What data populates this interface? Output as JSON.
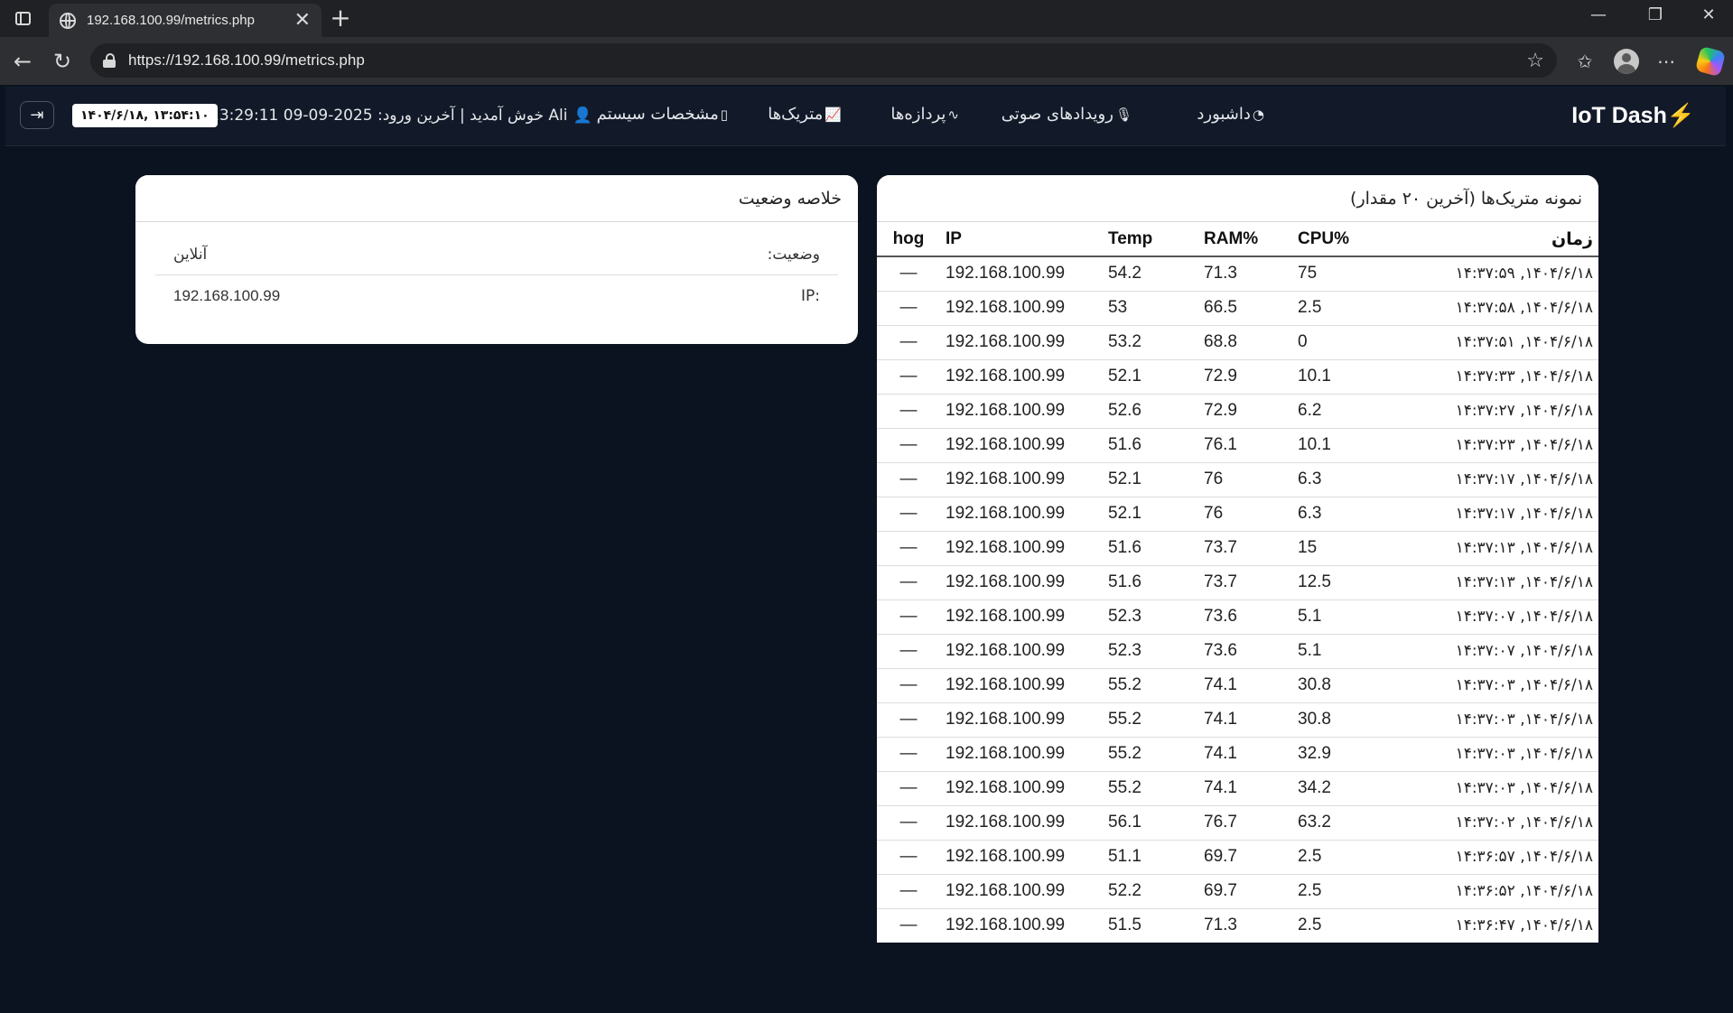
{
  "browser": {
    "tab_title": "192.168.100.99/metrics.php",
    "url": "https://192.168.100.99/metrics.php"
  },
  "nav": {
    "brand": "IoT Dash",
    "dashboard": "داشبورد",
    "audio_events": "رویدادهای صوتی",
    "processes": "پردازه‌ها",
    "metrics": "متریک‌ها",
    "system_specs": "مشخصات سیستم",
    "welcome": "Ali خوش آمدید | آخرین ورود: 2025-09-09 13:29:11",
    "clock": "۱۴۰۴/۶/۱۸, ۱۳:۵۴:۱۰"
  },
  "metrics_card": {
    "title": "نمونه متریک‌ها (آخرین ۲۰ مقدار)",
    "columns": {
      "time": "زمان",
      "cpu": "%CPU",
      "ram": "%RAM",
      "temp": "Temp",
      "ip": "IP",
      "hog": "hog"
    },
    "rows": [
      {
        "time": "۱۴۰۴/۶/۱۸, ۱۴:۳۷:۵۹",
        "cpu": "75",
        "ram": "71.3",
        "temp": "54.2",
        "ip": "192.168.100.99",
        "hog": "—"
      },
      {
        "time": "۱۴۰۴/۶/۱۸, ۱۴:۳۷:۵۸",
        "cpu": "2.5",
        "ram": "66.5",
        "temp": "53",
        "ip": "192.168.100.99",
        "hog": "—"
      },
      {
        "time": "۱۴۰۴/۶/۱۸, ۱۴:۳۷:۵۱",
        "cpu": "0",
        "ram": "68.8",
        "temp": "53.2",
        "ip": "192.168.100.99",
        "hog": "—"
      },
      {
        "time": "۱۴۰۴/۶/۱۸, ۱۴:۳۷:۳۳",
        "cpu": "10.1",
        "ram": "72.9",
        "temp": "52.1",
        "ip": "192.168.100.99",
        "hog": "—"
      },
      {
        "time": "۱۴۰۴/۶/۱۸, ۱۴:۳۷:۲۷",
        "cpu": "6.2",
        "ram": "72.9",
        "temp": "52.6",
        "ip": "192.168.100.99",
        "hog": "—"
      },
      {
        "time": "۱۴۰۴/۶/۱۸, ۱۴:۳۷:۲۳",
        "cpu": "10.1",
        "ram": "76.1",
        "temp": "51.6",
        "ip": "192.168.100.99",
        "hog": "—"
      },
      {
        "time": "۱۴۰۴/۶/۱۸, ۱۴:۳۷:۱۷",
        "cpu": "6.3",
        "ram": "76",
        "temp": "52.1",
        "ip": "192.168.100.99",
        "hog": "—"
      },
      {
        "time": "۱۴۰۴/۶/۱۸, ۱۴:۳۷:۱۷",
        "cpu": "6.3",
        "ram": "76",
        "temp": "52.1",
        "ip": "192.168.100.99",
        "hog": "—"
      },
      {
        "time": "۱۴۰۴/۶/۱۸, ۱۴:۳۷:۱۳",
        "cpu": "15",
        "ram": "73.7",
        "temp": "51.6",
        "ip": "192.168.100.99",
        "hog": "—"
      },
      {
        "time": "۱۴۰۴/۶/۱۸, ۱۴:۳۷:۱۳",
        "cpu": "12.5",
        "ram": "73.7",
        "temp": "51.6",
        "ip": "192.168.100.99",
        "hog": "—"
      },
      {
        "time": "۱۴۰۴/۶/۱۸, ۱۴:۳۷:۰۷",
        "cpu": "5.1",
        "ram": "73.6",
        "temp": "52.3",
        "ip": "192.168.100.99",
        "hog": "—"
      },
      {
        "time": "۱۴۰۴/۶/۱۸, ۱۴:۳۷:۰۷",
        "cpu": "5.1",
        "ram": "73.6",
        "temp": "52.3",
        "ip": "192.168.100.99",
        "hog": "—"
      },
      {
        "time": "۱۴۰۴/۶/۱۸, ۱۴:۳۷:۰۳",
        "cpu": "30.8",
        "ram": "74.1",
        "temp": "55.2",
        "ip": "192.168.100.99",
        "hog": "—"
      },
      {
        "time": "۱۴۰۴/۶/۱۸, ۱۴:۳۷:۰۳",
        "cpu": "30.8",
        "ram": "74.1",
        "temp": "55.2",
        "ip": "192.168.100.99",
        "hog": "—"
      },
      {
        "time": "۱۴۰۴/۶/۱۸, ۱۴:۳۷:۰۳",
        "cpu": "32.9",
        "ram": "74.1",
        "temp": "55.2",
        "ip": "192.168.100.99",
        "hog": "—"
      },
      {
        "time": "۱۴۰۴/۶/۱۸, ۱۴:۳۷:۰۳",
        "cpu": "34.2",
        "ram": "74.1",
        "temp": "55.2",
        "ip": "192.168.100.99",
        "hog": "—"
      },
      {
        "time": "۱۴۰۴/۶/۱۸, ۱۴:۳۷:۰۲",
        "cpu": "63.2",
        "ram": "76.7",
        "temp": "56.1",
        "ip": "192.168.100.99",
        "hog": "—"
      },
      {
        "time": "۱۴۰۴/۶/۱۸, ۱۴:۳۶:۵۷",
        "cpu": "2.5",
        "ram": "69.7",
        "temp": "51.1",
        "ip": "192.168.100.99",
        "hog": "—"
      },
      {
        "time": "۱۴۰۴/۶/۱۸, ۱۴:۳۶:۵۲",
        "cpu": "2.5",
        "ram": "69.7",
        "temp": "52.2",
        "ip": "192.168.100.99",
        "hog": "—"
      },
      {
        "time": "۱۴۰۴/۶/۱۸, ۱۴:۳۶:۴۷",
        "cpu": "2.5",
        "ram": "71.3",
        "temp": "51.5",
        "ip": "192.168.100.99",
        "hog": "—"
      }
    ]
  },
  "status_card": {
    "title": "خلاصه وضعیت",
    "status_label": "وضعیت:",
    "status_value": "آنلاین",
    "ip_label": "IP:",
    "ip_value": "192.168.100.99"
  }
}
